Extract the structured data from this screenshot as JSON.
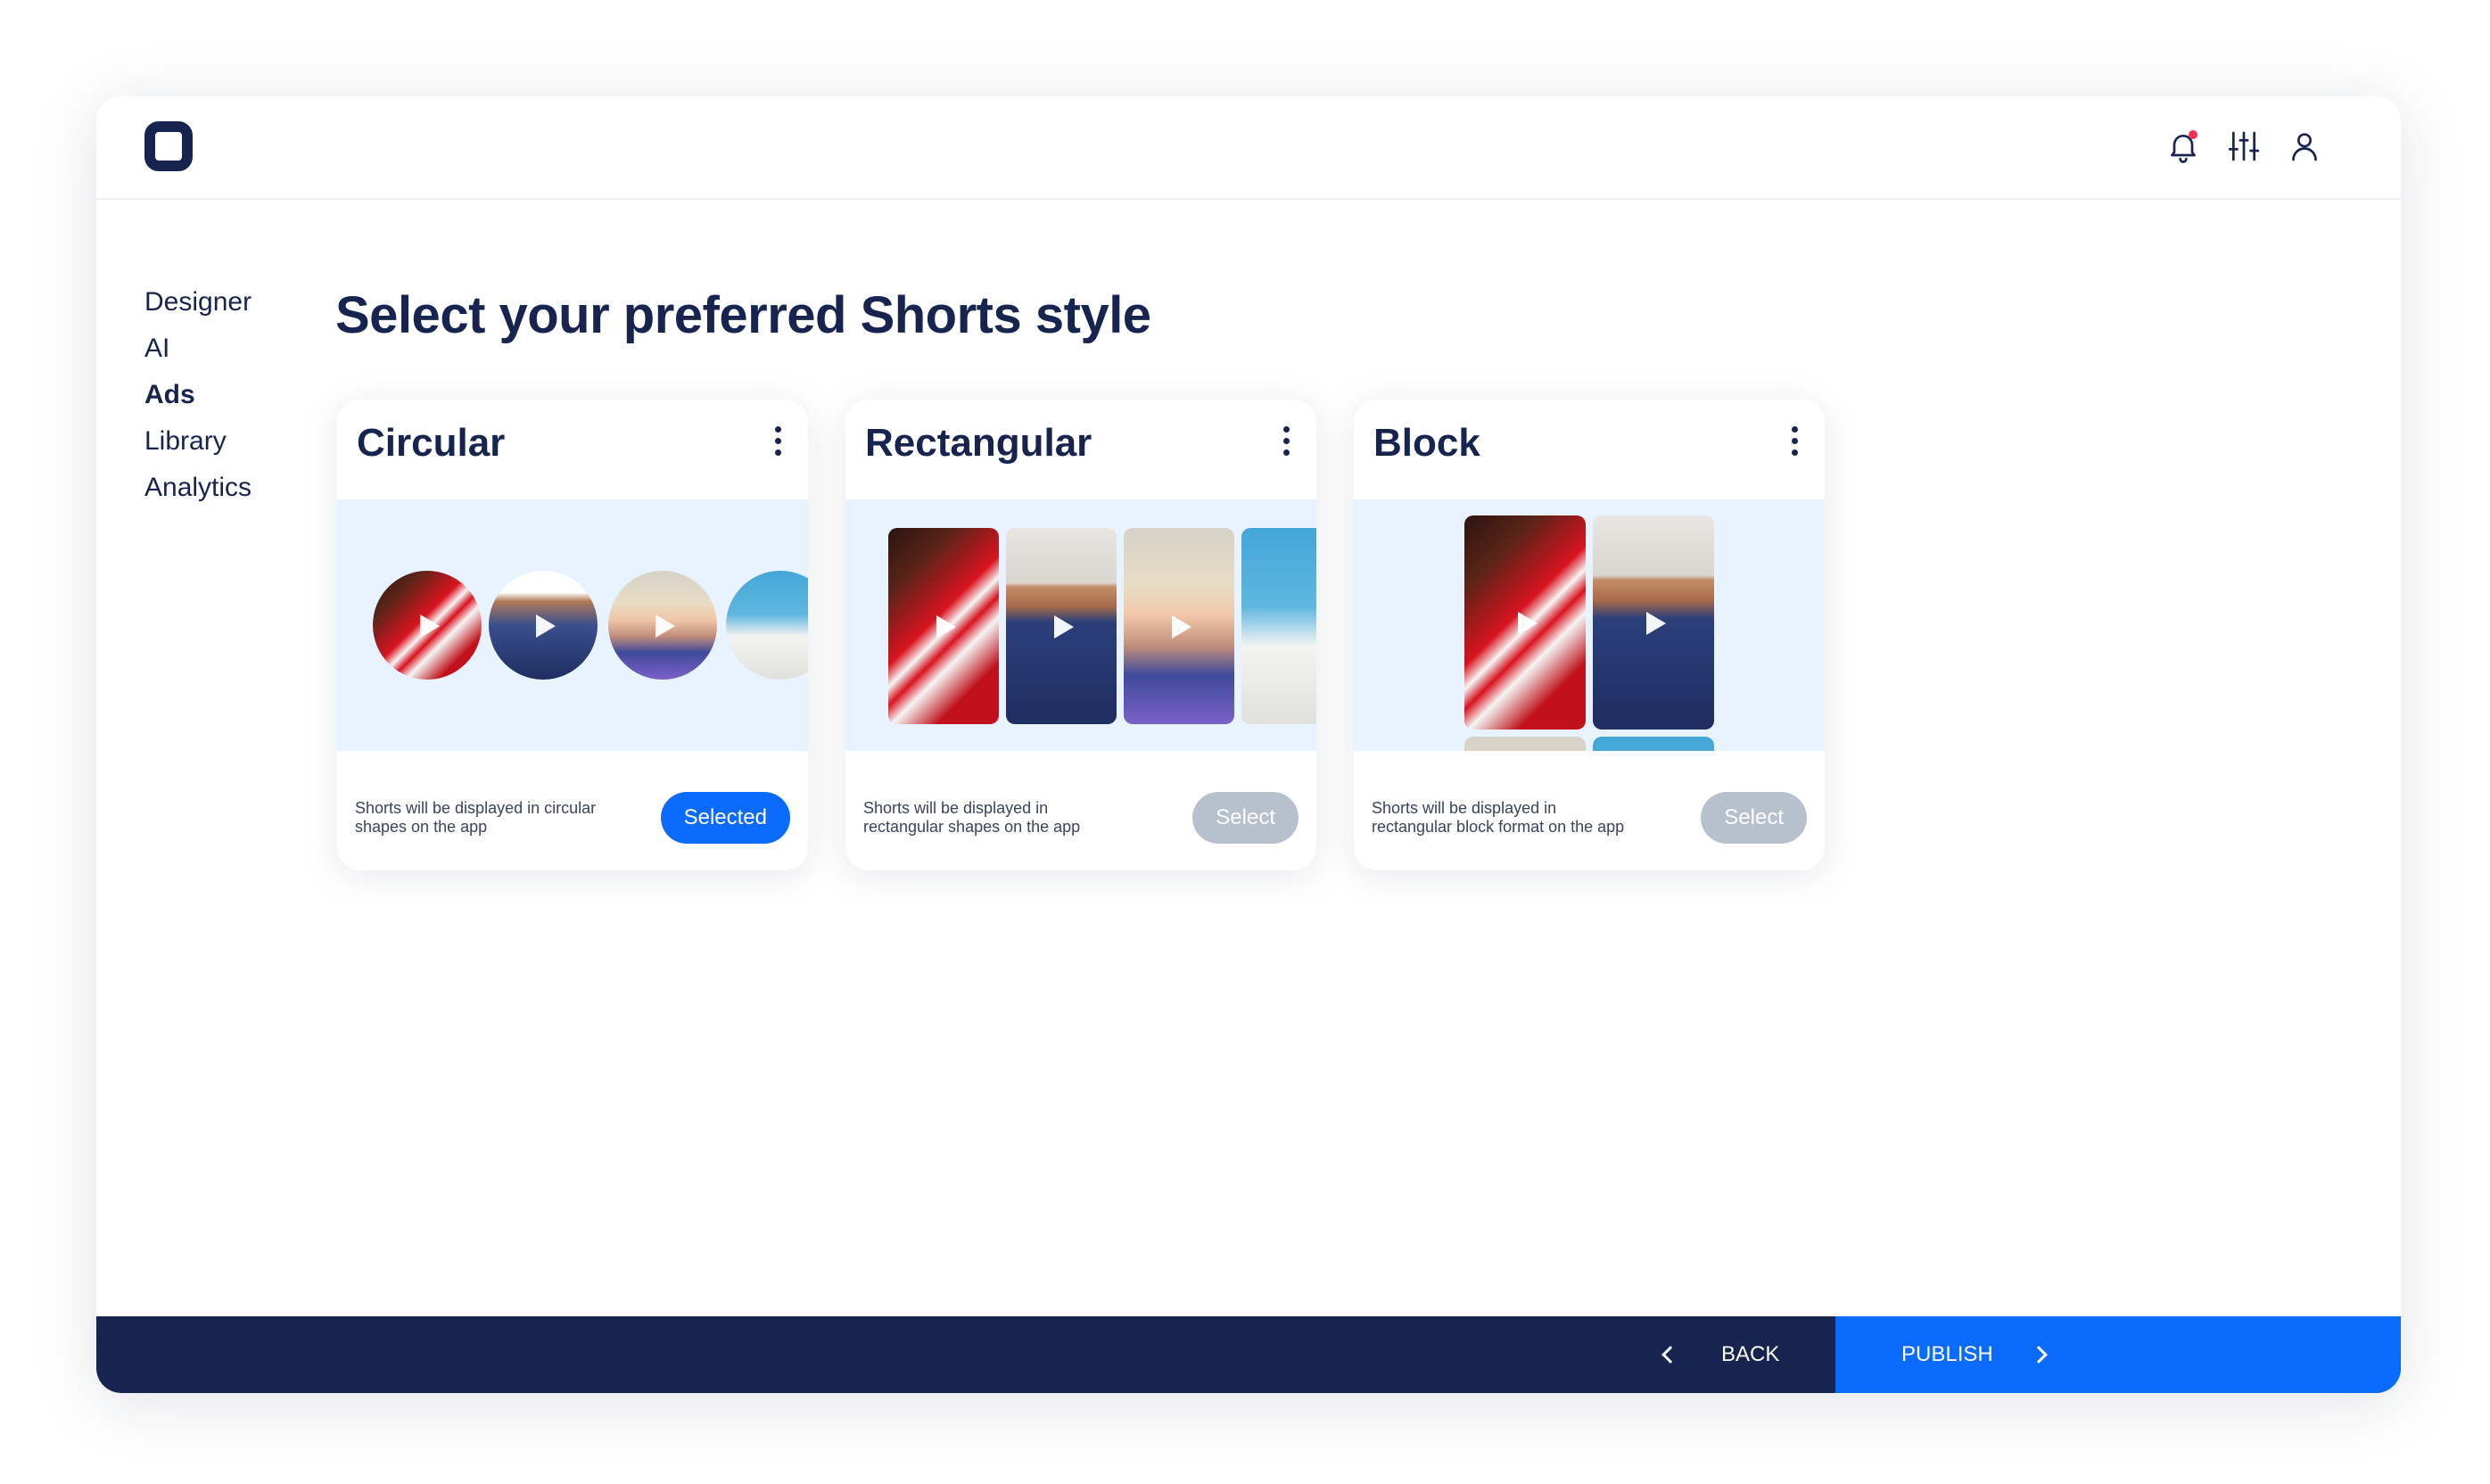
{
  "header": {
    "logo": "app-logo",
    "icons": [
      "bell-icon",
      "sliders-icon",
      "user-icon"
    ]
  },
  "sidebar": {
    "items": [
      {
        "label": "Designer"
      },
      {
        "label": "AI"
      },
      {
        "label": "Ads",
        "active": true
      },
      {
        "label": "Library"
      },
      {
        "label": "Analytics"
      }
    ]
  },
  "main": {
    "title": "Select your preferred Shorts style",
    "cards": [
      {
        "title": "Circular",
        "description": "Shorts will be displayed in circular shapes on the app",
        "button": "Selected",
        "selected": true
      },
      {
        "title": "Rectangular",
        "description": "Shorts will be displayed in rectangular shapes on the app",
        "button": "Select",
        "selected": false
      },
      {
        "title": "Block",
        "description": "Shorts will be displayed in rectangular block format on the app",
        "button": "Select",
        "selected": false
      }
    ]
  },
  "footer": {
    "back_label": "BACK",
    "publish_label": "PUBLISH"
  },
  "colors": {
    "navy": "#172450",
    "accent": "#0b6bff",
    "disabled": "#b7c0cd",
    "preview_bg": "#e9f3ff",
    "notification": "#ff2d55"
  }
}
